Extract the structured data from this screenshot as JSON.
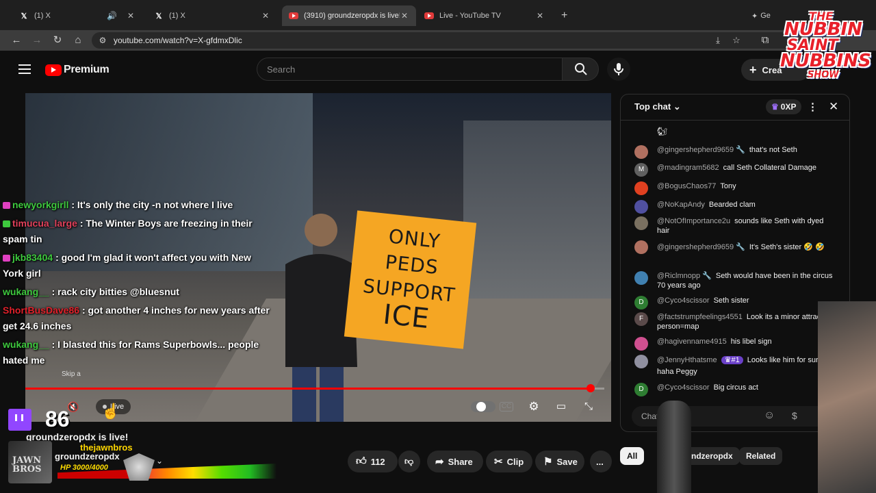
{
  "browser": {
    "tabs": [
      {
        "title": "(1) X"
      },
      {
        "title": "(1) X"
      },
      {
        "title": "(3910) groundzeropdx is live! -"
      },
      {
        "title": "Live - YouTube TV"
      }
    ],
    "new_tab": "+",
    "gemini_partial": "Ge",
    "url": "youtube.com/watch?v=X-gfdmxDlic"
  },
  "youtube": {
    "logo_word": "Premium",
    "search_placeholder": "Search",
    "create_label": "Crea"
  },
  "video": {
    "sign_lines": [
      "ONLY PEDS",
      "SUPPORT",
      "ICE"
    ],
    "live_label": "Live",
    "skip_text": "Skip a",
    "progress_fraction": 0.976
  },
  "overlay_chat": [
    {
      "user": "newyorkgirll",
      "text": ": It's only the city -n not where I live",
      "color": "#3ec93e"
    },
    {
      "user": "timucua_large",
      "text": ": The Winter Boys are freezing in their spam tin",
      "color": "#e0405a"
    },
    {
      "user": "jkb83404",
      "text": ": good I'm glad it won't affect you with New York girl",
      "color": "#3ec93e"
    },
    {
      "user": "wukang__",
      "text": ": rack city bitties @bluesnut",
      "color": "#3ec93e"
    },
    {
      "user": "ShortBusDave86",
      "text": ": got another 4 inches for new years after get 24.6 inches",
      "color": "#e0202a"
    },
    {
      "user": "wukang__",
      "text": ": I blasted this for Rams Superbowls... people hated me",
      "color": "#3ec93e"
    }
  ],
  "twitch": {
    "viewer_count": "86",
    "live_title": "groundzeropdx is live!"
  },
  "channel": {
    "avatar_text": "JAWN BROS",
    "overlay_name": "thejawnbros",
    "name": "groundzeropdx",
    "hp_text": "HP 3000/4000"
  },
  "actions": {
    "likes": "112",
    "share": "Share",
    "clip": "Clip",
    "save": "Save",
    "more": "..."
  },
  "chat": {
    "header": "Top chat",
    "xp": "0XP",
    "input_placeholder": "Chat...",
    "messages": [
      {
        "author": "@gingershepherd9659 🔧",
        "text": "that's not Seth",
        "avatar_color": "#b07060",
        "initial": ""
      },
      {
        "author": "@madingram5682",
        "text": "call Seth Collateral Damage",
        "avatar_color": "#606060",
        "initial": "M"
      },
      {
        "author": "@BogusChaos77",
        "text": "Tony",
        "avatar_color": "#e04020",
        "initial": ""
      },
      {
        "author": "@NoKapAndy",
        "text": "Bearded clam",
        "avatar_color": "#5050a0",
        "initial": ""
      },
      {
        "author": "@NotOfImportance2u",
        "text": "sounds like Seth with dyed hair",
        "avatar_color": "#7a7060",
        "initial": ""
      },
      {
        "author": "@gingershepherd9659 🔧",
        "text": "It's Seth's sister 🤣 🤣",
        "avatar_color": "#b07060",
        "initial": ""
      },
      {
        "author": "@Riclmnopp 🔧",
        "text": "Seth would have been in the circus 70 years ago",
        "avatar_color": "#4080b0",
        "initial": ""
      },
      {
        "author": "@Cyco4scissor",
        "text": "Seth sister",
        "avatar_color": "#2e7d32",
        "initial": "D"
      },
      {
        "author": "@factstrumpfeelings4551",
        "text": "Look its a minor attracted person=map",
        "avatar_color": "#5a4a4a",
        "initial": "F"
      },
      {
        "author": "@hagivenname4915",
        "text": "his libel sign",
        "avatar_color": "#d05090",
        "initial": ""
      },
      {
        "author": "@JennyHthatsme",
        "text": "Looks like him for sure haha Peggy",
        "avatar_color": "#9090a0",
        "initial": "",
        "member_badge": "#1"
      },
      {
        "author": "@Cyco4scissor",
        "text": "Big circus act",
        "avatar_color": "#2e7d32",
        "initial": "D"
      }
    ]
  },
  "chips": {
    "all": "All",
    "channel": "ndzeropdx",
    "related": "Related"
  },
  "show_logo": {
    "line1": "THE",
    "line2": "NUBBIN",
    "line3": "SAINT",
    "line4": "NUBBINS",
    "line5": "SHOW"
  }
}
